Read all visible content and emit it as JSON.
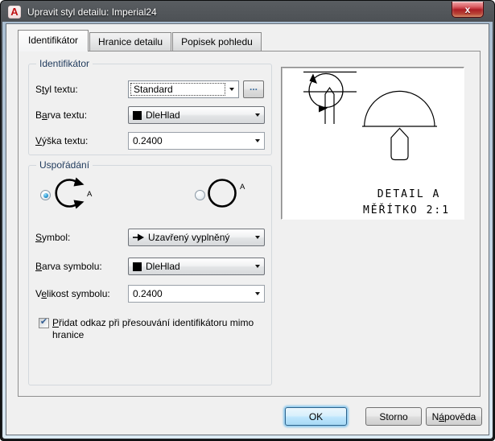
{
  "window": {
    "title": "Upravit styl detailu: Imperial24"
  },
  "tabs": {
    "tab1": "Identifikátor",
    "tab2": "Hranice detailu",
    "tab3": "Popisek pohledu"
  },
  "identifier": {
    "title": "Identifikátor",
    "text_style_label": {
      "pre": "S",
      "key": "t",
      "post": "yl textu:"
    },
    "text_style_value": "Standard",
    "browse_label": "...",
    "text_color_label": {
      "pre": "B",
      "key": "a",
      "post": "rva textu:"
    },
    "text_color_value": "DleHlad",
    "text_height_label": {
      "pre": "",
      "key": "V",
      "post": "ýška textu:"
    },
    "text_height_value": "0.2400"
  },
  "arrangement": {
    "title": "Uspořádání",
    "option1_letter": "A",
    "option2_letter": "A",
    "symbol_label": {
      "pre": "",
      "key": "S",
      "post": "ymbol:"
    },
    "symbol_value": "Uzavřený vyplněný",
    "symbol_color_label": {
      "pre": "",
      "key": "B",
      "post": "arva symbolu:"
    },
    "symbol_color_value": "DleHlad",
    "symbol_size_label": {
      "pre": "V",
      "key": "e",
      "post": "likost symbolu:"
    },
    "symbol_size_value": "0.2400",
    "leader_checkbox_label": {
      "pre": "",
      "key": "P",
      "post": "řidat odkaz při přesouvání identifikátoru mimo hranice"
    },
    "leader_checkbox_checked": "true"
  },
  "preview": {
    "caption_line1": "DETAIL A",
    "caption_line2": "MĚŘÍTKO 2:1"
  },
  "footer": {
    "ok": "OK",
    "cancel": "Storno",
    "help": {
      "pre": "N",
      "key": "á",
      "post": "pověda"
    }
  },
  "icons": {
    "app_logo": "A",
    "close": "x",
    "check": "✔"
  },
  "colors": {
    "dialog_bg": "#f0f0f0",
    "titlebar": "#2b2e31",
    "close_button_red": "#c03038",
    "default_button_glow": "#58b4eb",
    "groupbox_title": "#1e395b",
    "swatch_black": "#000000"
  }
}
